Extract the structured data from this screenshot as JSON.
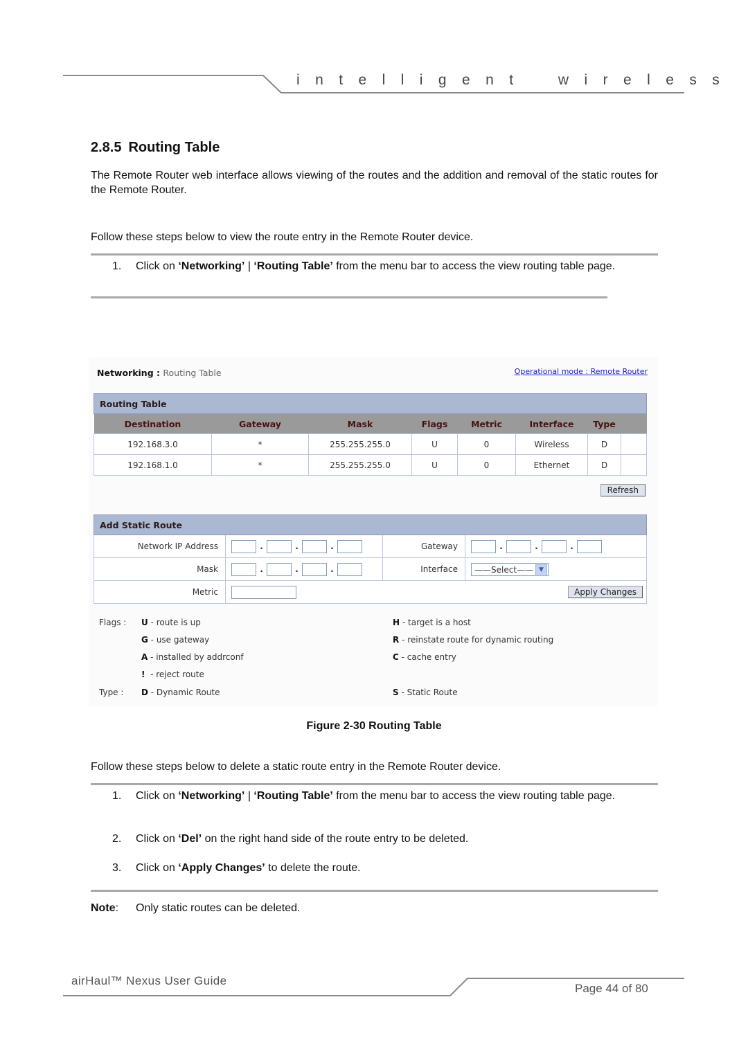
{
  "header": {
    "tagline": "i n t e l l i g e n t    w i r e l e s s    p l a t f o r m"
  },
  "section": {
    "number": "2.8.5",
    "title": "Routing Table"
  },
  "intro": "The Remote Router web interface allows viewing of the routes and the addition and removal of the static routes for the Remote Router.",
  "view_steps_intro": "Follow these steps below to view the route entry in the Remote Router device.",
  "view_steps": [
    {
      "num": "1.",
      "pre": "Click on ",
      "b1": "‘Networking’",
      "mid": " | ",
      "b2": "‘Routing Table’",
      "post": " from the menu bar to access the view routing table page."
    }
  ],
  "screenshot": {
    "breadcrumb_section": "Networking : ",
    "breadcrumb_page": "Routing Table",
    "operational_mode_link": "Operational mode : Remote Router",
    "routing_table": {
      "title": "Routing Table",
      "columns": [
        "Destination",
        "Gateway",
        "Mask",
        "Flags",
        "Metric",
        "Interface",
        "Type",
        ""
      ],
      "rows": [
        [
          "192.168.3.0",
          "*",
          "255.255.255.0",
          "U",
          "0",
          "Wireless",
          "D",
          ""
        ],
        [
          "192.168.1.0",
          "*",
          "255.255.255.0",
          "U",
          "0",
          "Ethernet",
          "D",
          ""
        ]
      ],
      "refresh_label": "Refresh"
    },
    "add_static_route": {
      "title": "Add Static Route",
      "network_ip_label": "Network IP Address",
      "gateway_label": "Gateway",
      "mask_label": "Mask",
      "interface_label": "Interface",
      "interface_selected": "——Select——",
      "metric_label": "Metric",
      "octet_separator": ".",
      "apply_label": "Apply Changes"
    },
    "legend": {
      "flags_label": "Flags :",
      "type_label": "Type :",
      "flags_left": [
        {
          "code": "U",
          "desc": " - route is up"
        },
        {
          "code": "G",
          "desc": " - use gateway"
        },
        {
          "code": "A",
          "desc": " - installed by addrconf"
        },
        {
          "code": "!",
          "desc": "  - reject route"
        }
      ],
      "flags_right": [
        {
          "code": "H",
          "desc": " - target is a host"
        },
        {
          "code": "R",
          "desc": " - reinstate route for dynamic routing"
        },
        {
          "code": "C",
          "desc": " - cache entry"
        }
      ],
      "type_left": {
        "code": "D",
        "desc": " - Dynamic Route"
      },
      "type_right": {
        "code": "S",
        "desc": " - Static Route"
      }
    }
  },
  "figure_caption": "Figure 2-30 Routing Table",
  "delete_steps_intro": "Follow these steps below to delete a static route entry in the Remote Router device.",
  "delete_steps": [
    {
      "num": "1.",
      "pre": "Click on ",
      "b1": "‘Networking’",
      "mid": " | ",
      "b2": "‘Routing Table’",
      "post": " from the menu bar to access the view routing table page."
    },
    {
      "num": "2.",
      "pre": "Click on ",
      "b1": "‘Del’",
      "post": " on the right hand side of the route entry to be deleted."
    },
    {
      "num": "3.",
      "pre": "Click on ",
      "b1": "‘Apply Changes’",
      "post": " to delete the route."
    }
  ],
  "note": {
    "label": "Note",
    "text": "Only static routes can be deleted."
  },
  "footer": {
    "doc_title": "airHaul™ Nexus User Guide",
    "page": "Page 44 of 80"
  }
}
